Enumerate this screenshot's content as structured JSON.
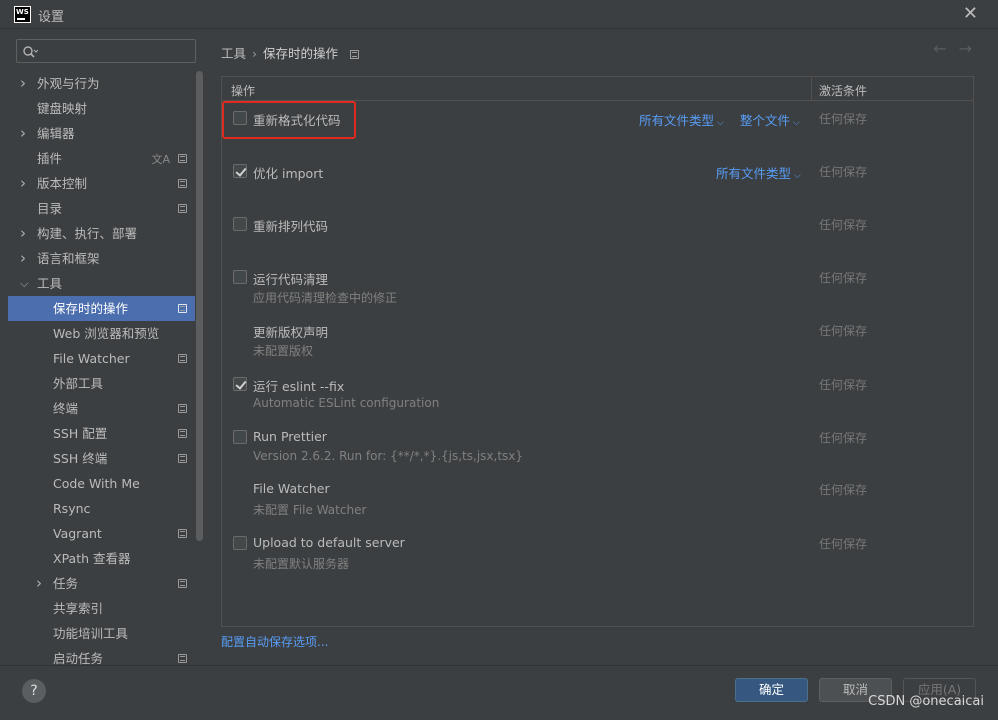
{
  "window": {
    "title": "设置",
    "logo_text": "WS"
  },
  "sidebar": {
    "search": {
      "value": "",
      "placeholder": ""
    },
    "items": [
      {
        "label": "外观与行为",
        "expandable": true,
        "expanded": false,
        "level": 0
      },
      {
        "label": "键盘映射",
        "expandable": false,
        "level": 0
      },
      {
        "label": "编辑器",
        "expandable": true,
        "expanded": false,
        "level": 0
      },
      {
        "label": "插件",
        "expandable": false,
        "level": 0
      },
      {
        "label": "版本控制",
        "expandable": true,
        "expanded": false,
        "level": 0
      },
      {
        "label": "目录",
        "expandable": false,
        "level": 0
      },
      {
        "label": "构建、执行、部署",
        "expandable": true,
        "expanded": false,
        "level": 0
      },
      {
        "label": "语言和框架",
        "expandable": true,
        "expanded": false,
        "level": 0
      },
      {
        "label": "工具",
        "expandable": true,
        "expanded": true,
        "level": 0
      },
      {
        "label": "保存时的操作",
        "level": 1,
        "selected": true
      },
      {
        "label": "Web 浏览器和预览",
        "level": 1
      },
      {
        "label": "File Watcher",
        "level": 1
      },
      {
        "label": "外部工具",
        "level": 1
      },
      {
        "label": "终端",
        "level": 1
      },
      {
        "label": "SSH 配置",
        "level": 1
      },
      {
        "label": "SSH 终端",
        "level": 1
      },
      {
        "label": "Code With Me",
        "level": 1
      },
      {
        "label": "Rsync",
        "level": 1
      },
      {
        "label": "Vagrant",
        "level": 1
      },
      {
        "label": "XPath 查看器",
        "level": 1
      },
      {
        "label": "任务",
        "expandable": true,
        "expanded": false,
        "level": 1
      },
      {
        "label": "共享索引",
        "level": 1
      },
      {
        "label": "功能培训工具",
        "level": 1
      },
      {
        "label": "启动任务",
        "level": 1
      }
    ]
  },
  "breadcrumb": {
    "parent": "工具",
    "separator": "›",
    "current": "保存时的操作"
  },
  "table": {
    "col_action": "操作",
    "col_condition": "激活条件",
    "rows": [
      {
        "label": "重新格式化代码",
        "sub": "",
        "checkbox": true,
        "checked": false,
        "link1": "所有文件类型",
        "link2": "整个文件",
        "condition": "任何保存"
      },
      {
        "label": "优化 import",
        "sub": "",
        "checkbox": true,
        "checked": true,
        "link1": "所有文件类型",
        "link2": "",
        "condition": "任何保存"
      },
      {
        "label": "重新排列代码",
        "sub": "",
        "checkbox": true,
        "checked": false,
        "link1": "",
        "link2": "",
        "condition": "任何保存"
      },
      {
        "label": "运行代码清理",
        "sub": "应用代码清理检查中的修正",
        "checkbox": true,
        "checked": false,
        "link1": "",
        "link2": "",
        "condition": "任何保存"
      },
      {
        "label": "更新版权声明",
        "sub": "未配置版权",
        "checkbox": false,
        "checked": false,
        "link1": "",
        "link2": "",
        "condition": "任何保存"
      },
      {
        "label": "运行 eslint --fix",
        "sub": "Automatic ESLint configuration",
        "checkbox": true,
        "checked": true,
        "link1": "",
        "link2": "",
        "condition": "任何保存"
      },
      {
        "label": "Run Prettier",
        "sub": "Version 2.6.2. Run for: {**/*,*}.{js,ts,jsx,tsx}",
        "checkbox": true,
        "checked": false,
        "link1": "",
        "link2": "",
        "condition": "任何保存"
      },
      {
        "label": "File Watcher",
        "sub": "未配置 File Watcher",
        "checkbox": false,
        "checked": false,
        "link1": "",
        "link2": "",
        "condition": "任何保存"
      },
      {
        "label": "Upload to default server",
        "sub": "未配置默认服务器",
        "checkbox": true,
        "checked": false,
        "link1": "",
        "link2": "",
        "condition": "任何保存"
      }
    ]
  },
  "config_link": "配置自动保存选项...",
  "footer": {
    "help": "?",
    "ok": "确定",
    "cancel": "取消",
    "apply": "应用(A)",
    "watermark": "CSDN @onecaicai"
  },
  "colors": {
    "accent": "#4b6eaf",
    "link": "#589df6",
    "highlight": "#e0291f",
    "ok_button": "#365880"
  }
}
